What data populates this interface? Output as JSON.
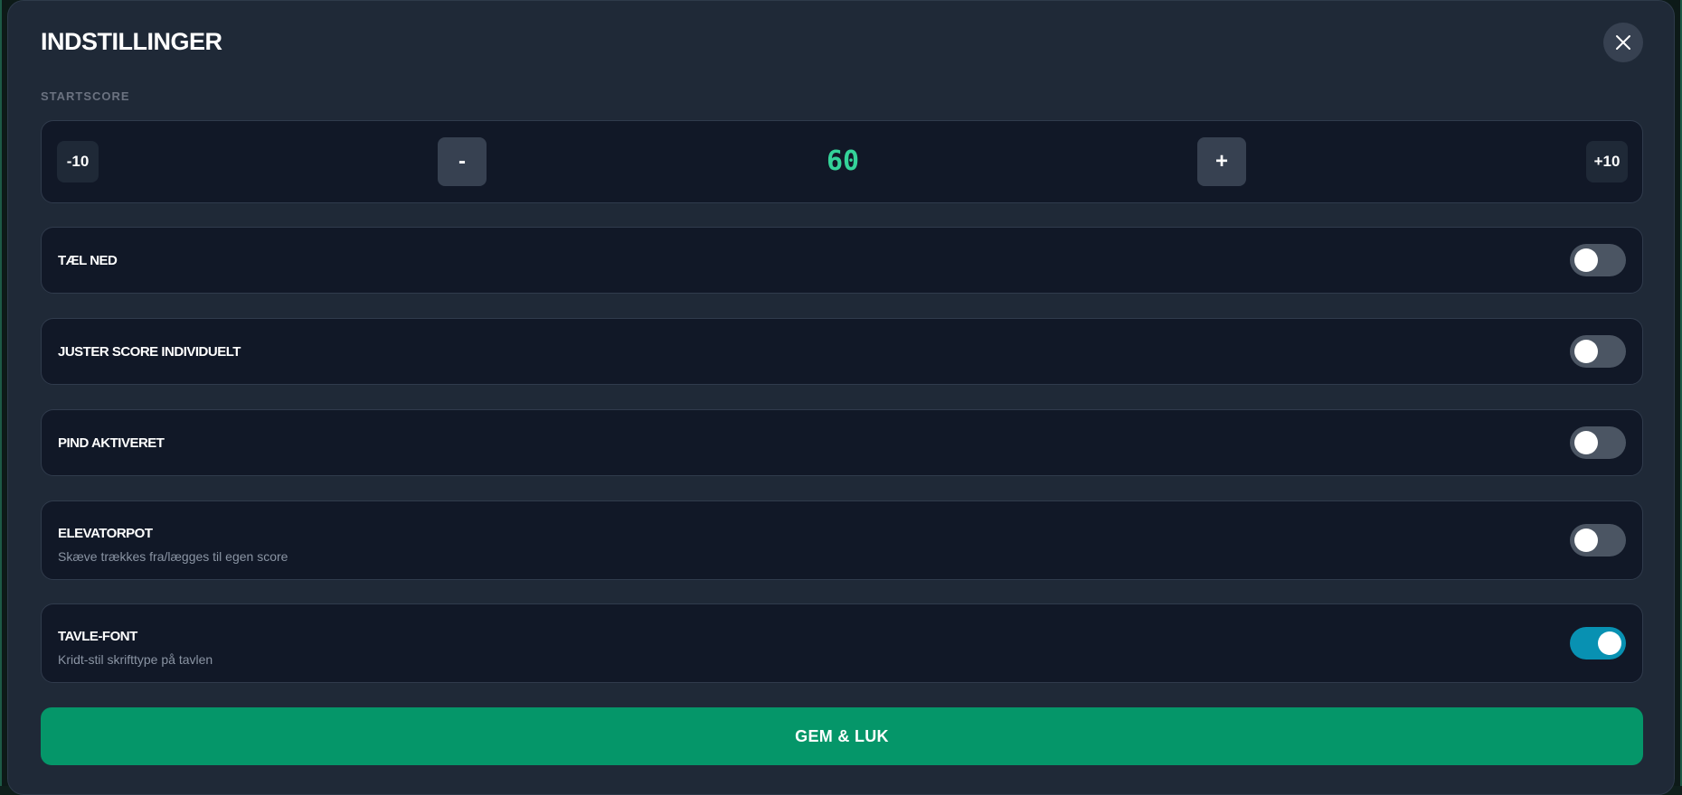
{
  "modal": {
    "title": "INDSTILLINGER",
    "close_icon": "close-icon"
  },
  "start_score": {
    "label": "STARTSCORE",
    "minus_ten": "-10",
    "minus_one": "-",
    "value": "60",
    "plus_one": "+",
    "plus_ten": "+10"
  },
  "settings": [
    {
      "label": "TÆL NED",
      "description": "",
      "enabled": false
    },
    {
      "label": "JUSTER SCORE INDIVIDUELT",
      "description": "",
      "enabled": false
    },
    {
      "label": "PIND AKTIVERET",
      "description": "",
      "enabled": false
    },
    {
      "label": "ELEVATORPOT",
      "description": "Skæve trækkes fra/lægges til egen score",
      "enabled": false
    },
    {
      "label": "TAVLE-FONT",
      "description": "Kridt-stil skrifttype på tavlen",
      "enabled": true
    }
  ],
  "save_button": "GEM & LUK",
  "colors": {
    "modal_bg": "#1f2937",
    "row_bg": "#111827",
    "score_accent": "#34d399",
    "toggle_on": "#0891b2",
    "toggle_off": "#4b5563",
    "save_bg": "#059669"
  }
}
